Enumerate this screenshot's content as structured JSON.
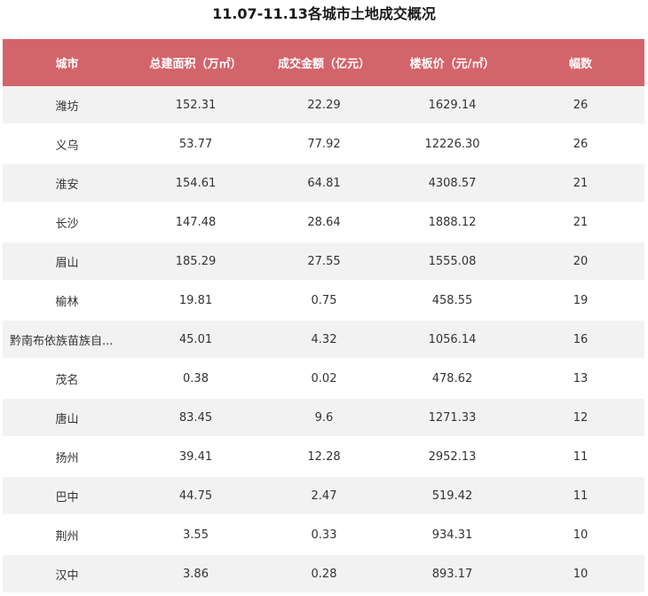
{
  "title": "11.07-11.13各城市土地成交概况",
  "chart_data": {
    "type": "table",
    "title": "11.07-11.13各城市土地成交概况",
    "columns": [
      "城市",
      "总建面积（万㎡）",
      "成交金额（亿元）",
      "楼板价（元/㎡）",
      "幅数"
    ],
    "rows": [
      [
        "潍坊",
        "152.31",
        "22.29",
        "1629.14",
        "26"
      ],
      [
        "义乌",
        "53.77",
        "77.92",
        "12226.30",
        "26"
      ],
      [
        "淮安",
        "154.61",
        "64.81",
        "4308.57",
        "21"
      ],
      [
        "长沙",
        "147.48",
        "28.64",
        "1888.12",
        "21"
      ],
      [
        "眉山",
        "185.29",
        "27.55",
        "1555.08",
        "20"
      ],
      [
        "榆林",
        "19.81",
        "0.75",
        "458.55",
        "19"
      ],
      [
        "黔南布依族苗族自...",
        "45.01",
        "4.32",
        "1056.14",
        "16"
      ],
      [
        "茂名",
        "0.38",
        "0.02",
        "478.62",
        "13"
      ],
      [
        "唐山",
        "83.45",
        "9.6",
        "1271.33",
        "12"
      ],
      [
        "扬州",
        "39.41",
        "12.28",
        "2952.13",
        "11"
      ],
      [
        "巴中",
        "44.75",
        "2.47",
        "519.42",
        "11"
      ],
      [
        "荆州",
        "3.55",
        "0.33",
        "934.31",
        "10"
      ],
      [
        "汉中",
        "3.86",
        "0.28",
        "893.17",
        "10"
      ]
    ]
  },
  "colors": {
    "header_bg": "#d4646b",
    "header_text": "#ffffff",
    "row_odd_bg": "#f2f2f2",
    "row_even_bg": "#ffffff"
  }
}
